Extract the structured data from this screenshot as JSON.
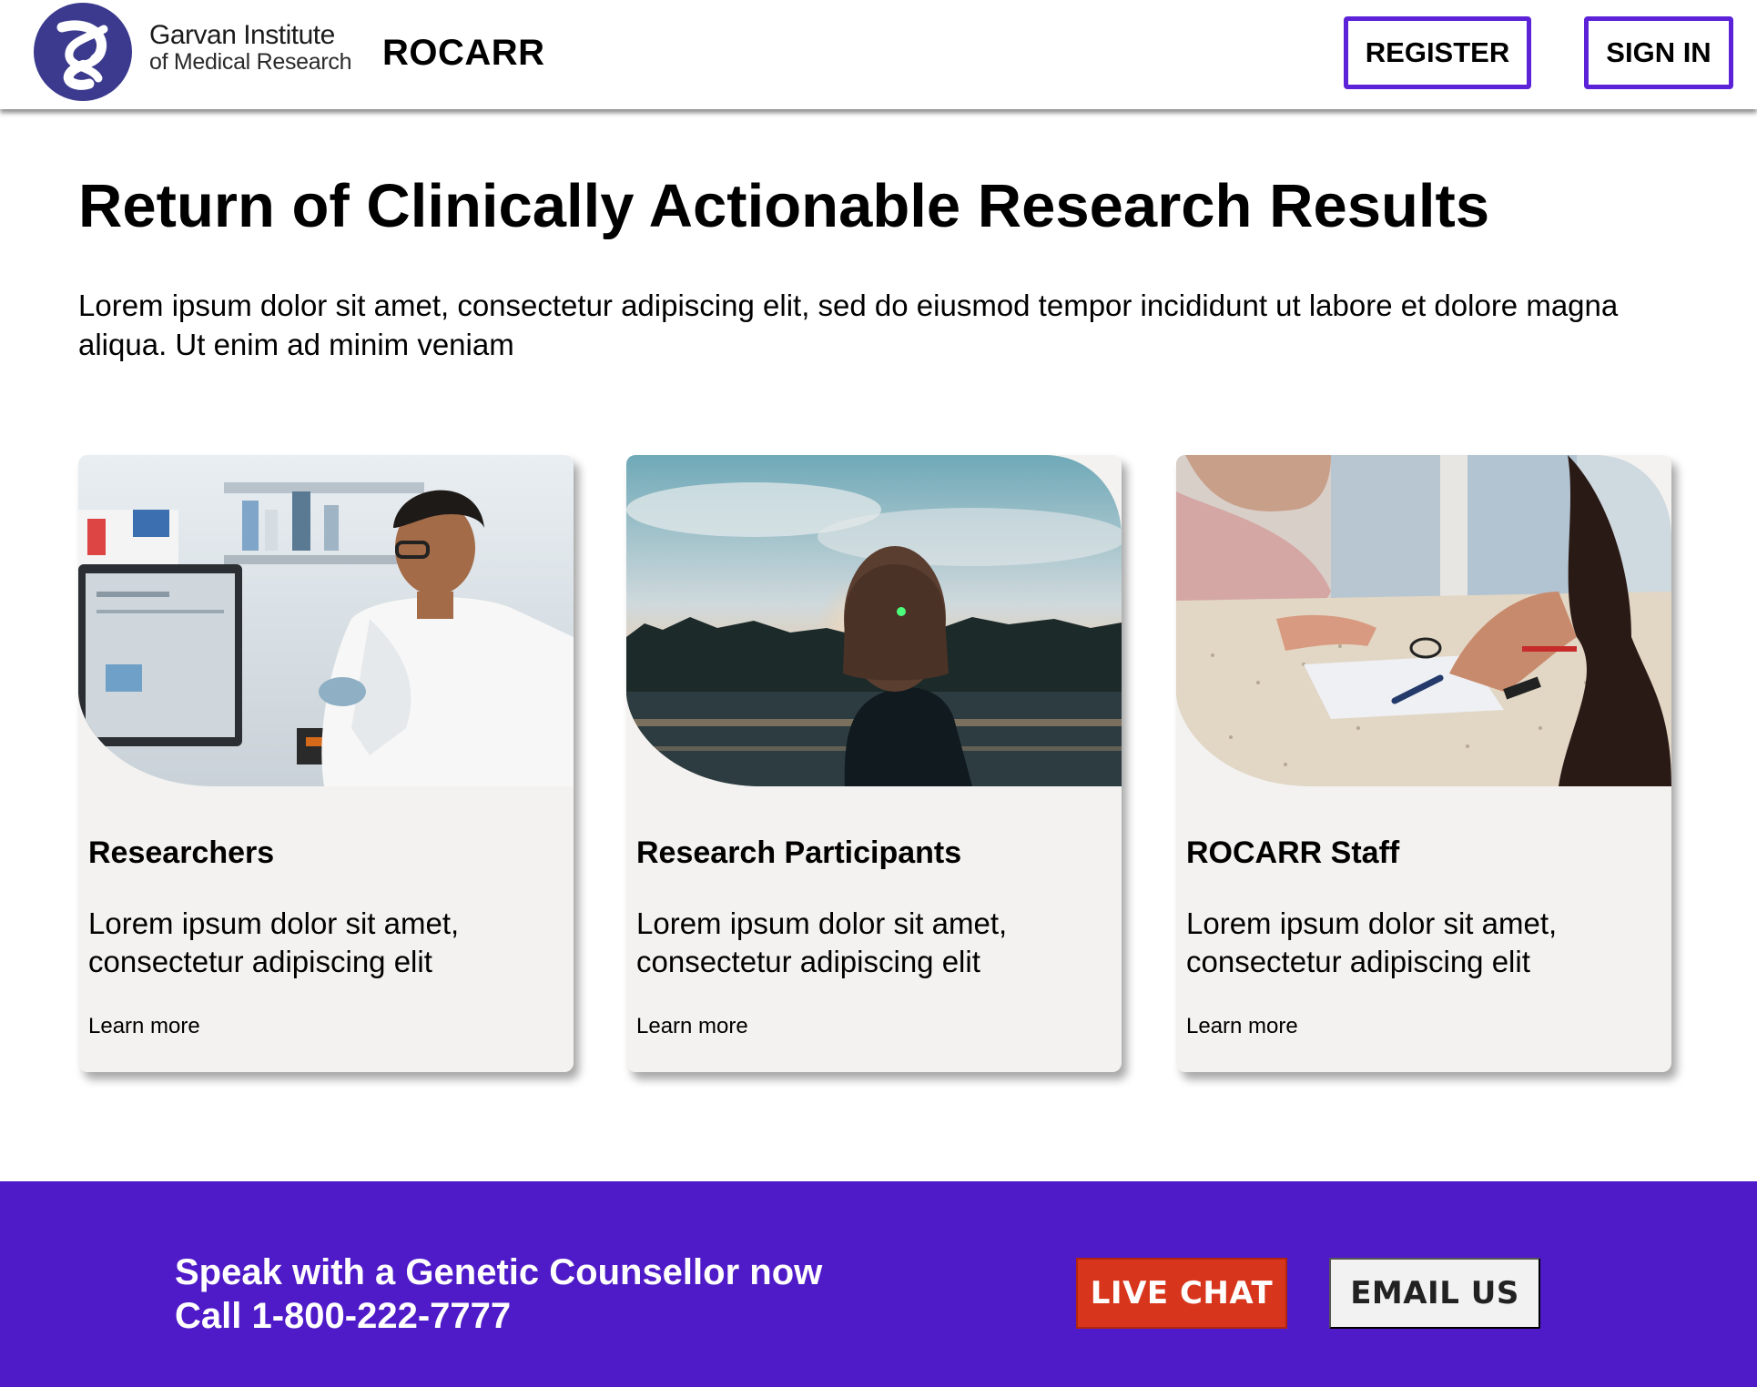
{
  "header": {
    "logo_line1": "Garvan Institute",
    "logo_line2": "of Medical Research",
    "app_name": "ROCARR",
    "register_label": "REGISTER",
    "signin_label": "SIGN IN"
  },
  "hero": {
    "title": "Return of Clinically Actionable Research Results",
    "text": "Lorem ipsum dolor sit amet, consectetur adipiscing elit, sed do eiusmod tempor incididunt ut labore et dolore magna aliqua. Ut enim ad minim veniam"
  },
  "cards": [
    {
      "title": "Researchers",
      "text": "Lorem ipsum dolor sit amet, consectetur adipiscing elit",
      "link": "Learn more",
      "image": "researcher-in-lab-photo"
    },
    {
      "title": "Research Participants",
      "text": "Lorem ipsum dolor sit amet, consectetur adipiscing elit",
      "link": "Learn more",
      "image": "woman-at-sunset-lake-photo"
    },
    {
      "title": "ROCARR Staff",
      "text": "Lorem ipsum dolor sit amet, consectetur adipiscing elit",
      "link": "Learn more",
      "image": "two-people-at-table-photo"
    }
  ],
  "banner": {
    "line1": "Speak with a Genetic Counsellor now",
    "line2": "Call 1-800-222-7777",
    "chat_label": "LIVE CHAT",
    "email_label": "EMAIL US"
  },
  "colors": {
    "accent": "#5b22d8",
    "banner_bg": "#4f1bc8",
    "chat_button": "#d7361c",
    "card_bg": "#f3f2f0",
    "logo": "#3a3a8c"
  }
}
